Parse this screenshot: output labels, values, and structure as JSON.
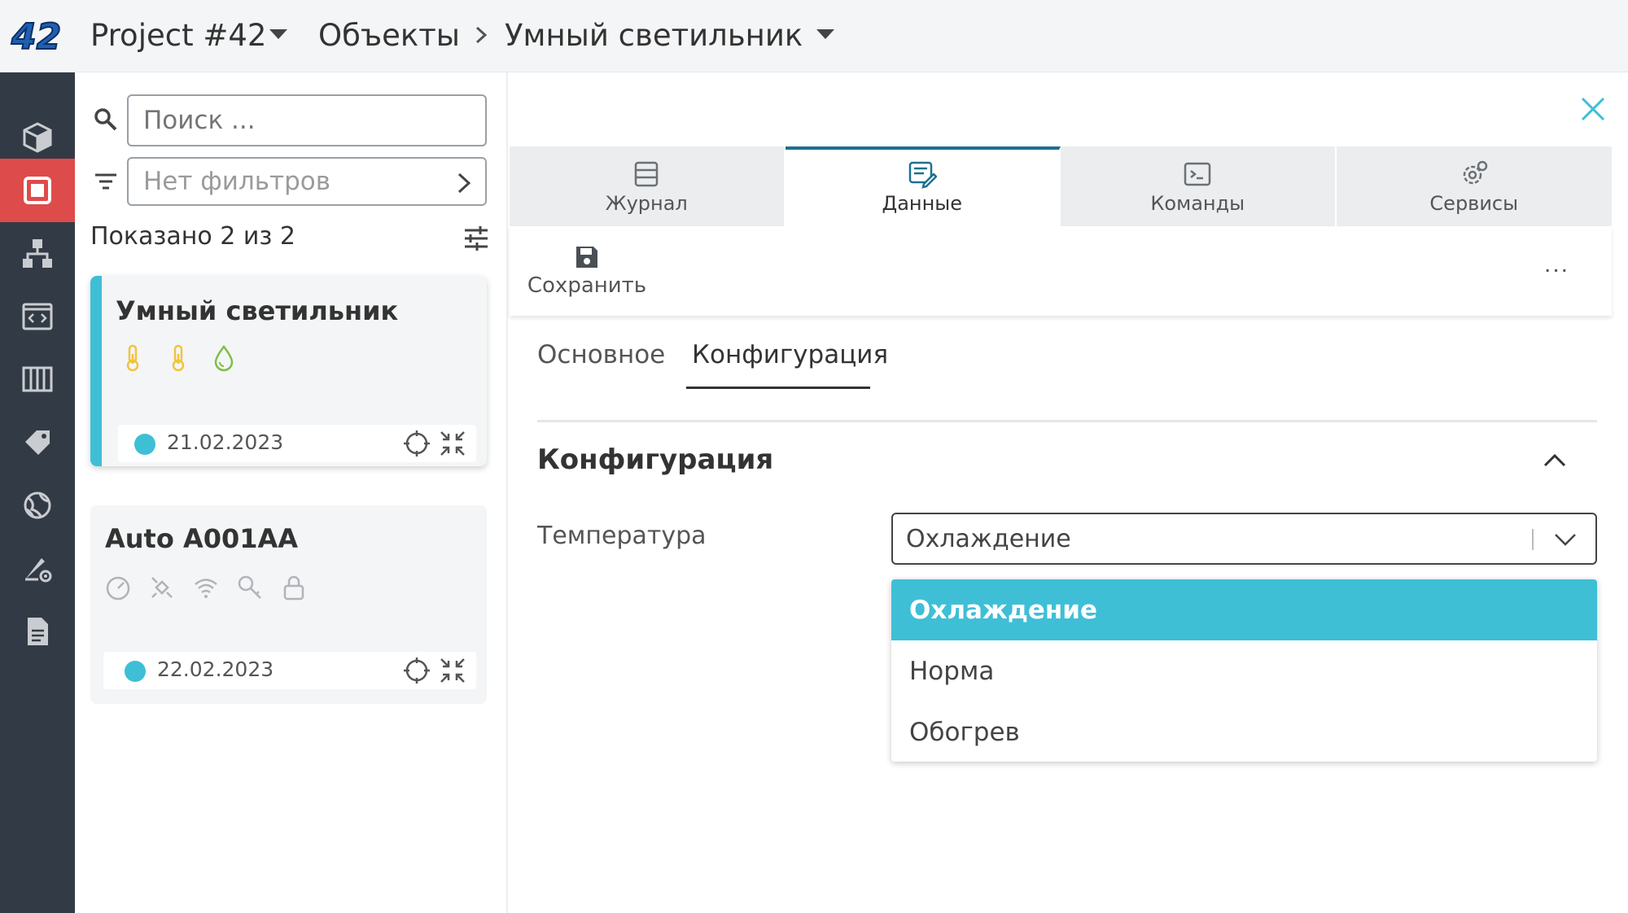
{
  "topbar": {
    "logo_text": "42",
    "project": "Project #42",
    "objects": "Объекты",
    "device": "Умный светильник"
  },
  "rail": {
    "items": [
      "cube-icon",
      "device-icon",
      "hierarchy-icon",
      "code-icon",
      "columns-icon",
      "tag-icon",
      "globe-icon",
      "settings-icon",
      "document-icon"
    ],
    "active_index": 1
  },
  "list": {
    "search_placeholder": "Поиск ...",
    "filter_text": "Нет фильтров",
    "shown_prefix": "Показано",
    "shown_count": "2",
    "shown_mid": "из",
    "shown_total": "2",
    "items": [
      {
        "title": "Умный светильник",
        "icons": [
          "thermometer-icon",
          "thermometer-icon",
          "drop-icon"
        ],
        "date": "21.02.2023"
      },
      {
        "title": "Auto A001AA",
        "icons": [
          "speedometer-icon",
          "satellite-icon",
          "wifi-icon",
          "key-icon",
          "lock-icon"
        ],
        "date": "22.02.2023"
      }
    ]
  },
  "detail": {
    "tabs": [
      "Журнал",
      "Данные",
      "Команды",
      "Сервисы"
    ],
    "active_tab": 1,
    "save_label": "Сохранить",
    "more_label": "...",
    "subtabs": [
      "Основное",
      "Конфигурация"
    ],
    "active_subtab": 1,
    "section_title": "Конфигурация",
    "field_label": "Температура",
    "select_value": "Охлаждение",
    "options": [
      "Охлаждение",
      "Норма",
      "Обогрев"
    ],
    "selected_option": 0
  },
  "colors": {
    "accent": "#3ebfd6",
    "rail_bg": "#323b45",
    "rail_active": "#de4b4b",
    "tab_active_border": "#1d7090",
    "icon_yellow": "#f0c53a",
    "icon_green": "#7bc043"
  }
}
